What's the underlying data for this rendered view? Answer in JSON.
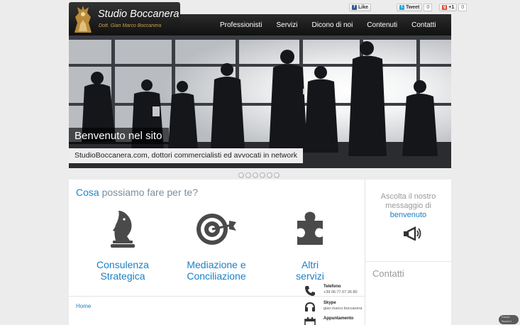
{
  "social": {
    "facebook": {
      "label": "Like"
    },
    "twitter": {
      "label": "Tweet",
      "count": "0"
    },
    "gplus": {
      "label": "+1",
      "count": "0"
    }
  },
  "logo": {
    "title": "Studio Boccanera",
    "subtitle": "Dott. Gian Marco Boccanera"
  },
  "nav": {
    "items": [
      "Professionisti",
      "Servizi",
      "Dicono di noi",
      "Contenuti",
      "Contatti"
    ]
  },
  "hero": {
    "caption_title": "Benvenuto nel sito",
    "caption_text": "StudioBoccanera.com, dottori commercialisti ed avvocati in network",
    "slides": 6
  },
  "main": {
    "title_highlight": "Cosa",
    "title_rest": "possiamo fare per te?",
    "services": [
      {
        "line1": "Consulenza",
        "line2": "Strategica",
        "icon": "chess-knight-icon"
      },
      {
        "line1": "Mediazione e",
        "line2": "Conciliazione",
        "icon": "target-dart-icon"
      },
      {
        "line1": "Altri",
        "line2": "servizi",
        "icon": "puzzle-piece-icon"
      }
    ],
    "breadcrumb": "Home"
  },
  "sidebar": {
    "message_line1": "Ascolta il nostro",
    "message_line2": "messaggio di",
    "message_line3": "benvenuto",
    "contacts_title": "Contatti",
    "contacts": [
      {
        "label": "Telefono",
        "value": "+39 06.77.07.36.80",
        "icon": "phone-icon"
      },
      {
        "label": "Skype",
        "value": "gian.marco.boccanera",
        "icon": "headset-icon"
      },
      {
        "label": "Appuntamento",
        "value": "",
        "icon": "calendar-icon"
      }
    ]
  },
  "badge": {
    "line1": "Elastic",
    "line2": "Beyond"
  },
  "colors": {
    "accent": "#1a80c6",
    "header": "#1a1a1a",
    "logo_gold": "#c8a04c"
  }
}
